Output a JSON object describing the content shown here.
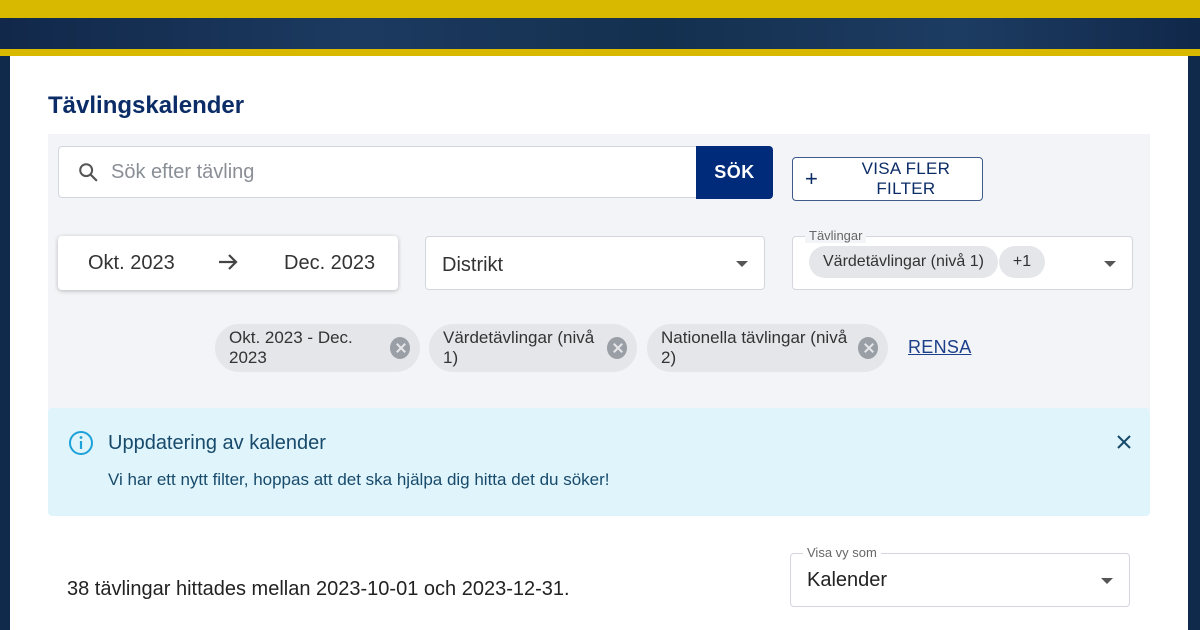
{
  "page": {
    "title": "Tävlingskalender"
  },
  "search": {
    "placeholder": "Sök efter tävling",
    "button_label": "SÖK",
    "more_filters_label": "VISA FLER FILTER"
  },
  "date_range": {
    "start": "Okt. 2023",
    "end": "Dec. 2023"
  },
  "district": {
    "placeholder": "Distrikt"
  },
  "competitions": {
    "label": "Tävlingar",
    "selected": "Värdetävlingar (nivå 1)",
    "more_count": "+1"
  },
  "active_filters": [
    {
      "label": "Okt. 2023 - Dec. 2023"
    },
    {
      "label": "Värdetävlingar (nivå 1)"
    },
    {
      "label": "Nationella tävlingar (nivå 2)"
    }
  ],
  "clear_label": "RENSA",
  "info": {
    "title": "Uppdatering av kalender",
    "text": "Vi har ett nytt filter, hoppas att det ska hjälpa dig hitta det du söker!"
  },
  "results": {
    "text": "38 tävlingar hittades mellan 2023-10-01 och 2023-12-31."
  },
  "view": {
    "label": "Visa vy som",
    "value": "Kalender"
  },
  "colors": {
    "brand_navy": "#0b2c66",
    "button_blue": "#002a7a",
    "gold": "#d9b800",
    "info_bg": "#e0f4fb",
    "info_icon": "#1da1d9"
  },
  "icons": {
    "search": "search-icon",
    "arrow": "arrow-right-icon",
    "info": "info-icon",
    "close": "close-icon",
    "caret": "chevron-down-icon",
    "remove": "remove-chip-icon",
    "plus": "plus-icon"
  }
}
